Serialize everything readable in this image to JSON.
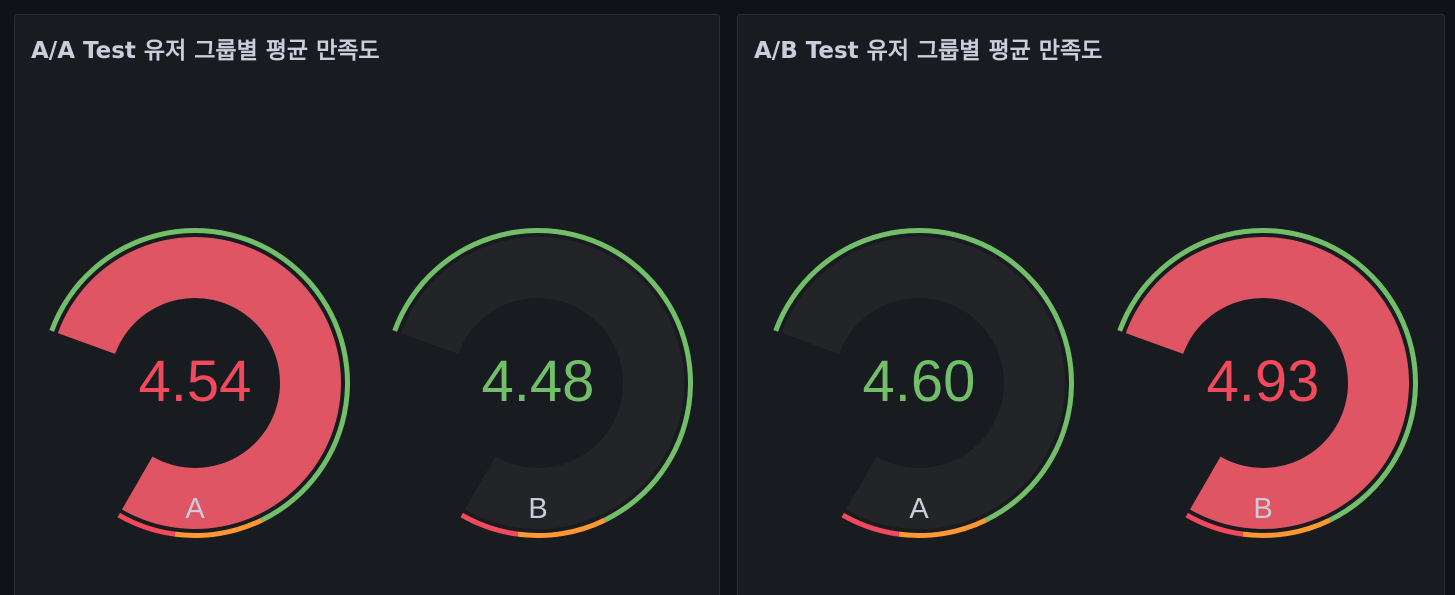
{
  "colors": {
    "green": "#73bf69",
    "orange": "#ff9830",
    "red": "#f2495c",
    "red_fill": "#e05563",
    "track": "#232428",
    "outline": "#181b1f"
  },
  "gauge_scale": {
    "min": 0,
    "max": 5,
    "thresholds": [
      {
        "from": 0,
        "color": "green"
      },
      {
        "from": 4,
        "color": "orange"
      },
      {
        "from": 4.6,
        "color": "red"
      }
    ],
    "range_fraction_of_scale": 0.55,
    "range_start_value": 2.75
  },
  "panels": [
    {
      "title": "A/A Test 유저 그룹별 평균 만족도",
      "gauges": [
        {
          "label": "A",
          "value": 4.54,
          "value_text": "4.54",
          "value_color": "red",
          "fill_color": "red_fill"
        },
        {
          "label": "B",
          "value": 4.48,
          "value_text": "4.48",
          "value_color": "green",
          "fill_color": null
        }
      ]
    },
    {
      "title": "A/B Test 유저 그룹별 평균 만족도",
      "gauges": [
        {
          "label": "A",
          "value": 4.6,
          "value_text": "4.60",
          "value_color": "green",
          "fill_color": null
        },
        {
          "label": "B",
          "value": 4.93,
          "value_text": "4.93",
          "value_color": "red",
          "fill_color": "red_fill"
        }
      ]
    }
  ]
}
